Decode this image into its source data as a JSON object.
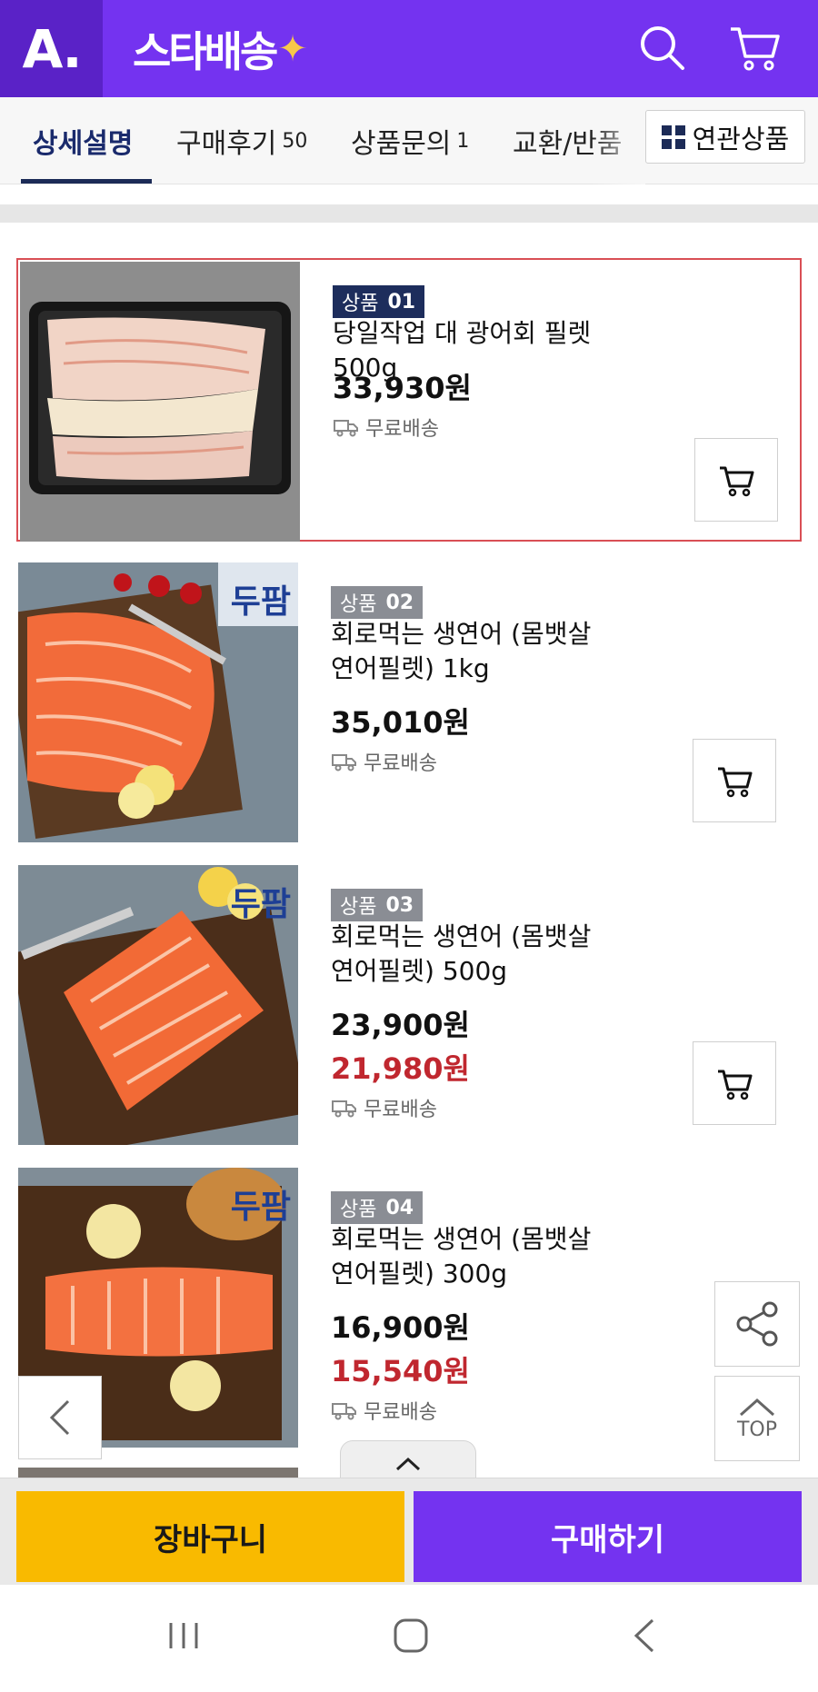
{
  "header": {
    "logo_text": "A.",
    "brand_text": "스타배송",
    "brand_accent": "✦",
    "search_icon": "search-icon",
    "cart_icon": "cart-icon"
  },
  "tabs": [
    {
      "label": "상세설명",
      "count": "",
      "active": true
    },
    {
      "label": "구매후기",
      "count": "50",
      "active": false
    },
    {
      "label": "상품문의",
      "count": "1",
      "active": false
    },
    {
      "label": "교환/반품",
      "count": "",
      "active": false
    }
  ],
  "related_button": {
    "label": "연관상품"
  },
  "products": [
    {
      "badge_label": "상품",
      "badge_number": "01",
      "name_line1": "당일작업 대 광어회 필렛 500g",
      "name_line2": "",
      "price": "33,930원",
      "sale_price": "",
      "shipping": "무료배송"
    },
    {
      "badge_label": "상품",
      "badge_number": "02",
      "name_line1": "회로먹는 생연어 (몸뱃살",
      "name_line2": "연어필렛) 1kg",
      "price": "35,010원",
      "sale_price": "",
      "shipping": "무료배송",
      "brand_mark": "두팜"
    },
    {
      "badge_label": "상품",
      "badge_number": "03",
      "name_line1": "회로먹는 생연어 (몸뱃살",
      "name_line2": "연어필렛) 500g",
      "price": "23,900원",
      "sale_price": "21,980원",
      "shipping": "무료배송",
      "brand_mark": "두팜"
    },
    {
      "badge_label": "상품",
      "badge_number": "04",
      "name_line1": "회로먹는 생연어 (몸뱃살",
      "name_line2": "연어필렛) 300g",
      "price": "16,900원",
      "sale_price": "15,540원",
      "shipping": "무료배송",
      "brand_mark": "두팜"
    }
  ],
  "floating": {
    "top_label": "TOP"
  },
  "actions": {
    "cart_label": "장바구니",
    "buy_label": "구매하기"
  },
  "colors": {
    "brand_purple": "#7433f0",
    "cart_yellow": "#f9ba00",
    "sale_red": "#c0272f",
    "selected_border": "#d94f55"
  }
}
